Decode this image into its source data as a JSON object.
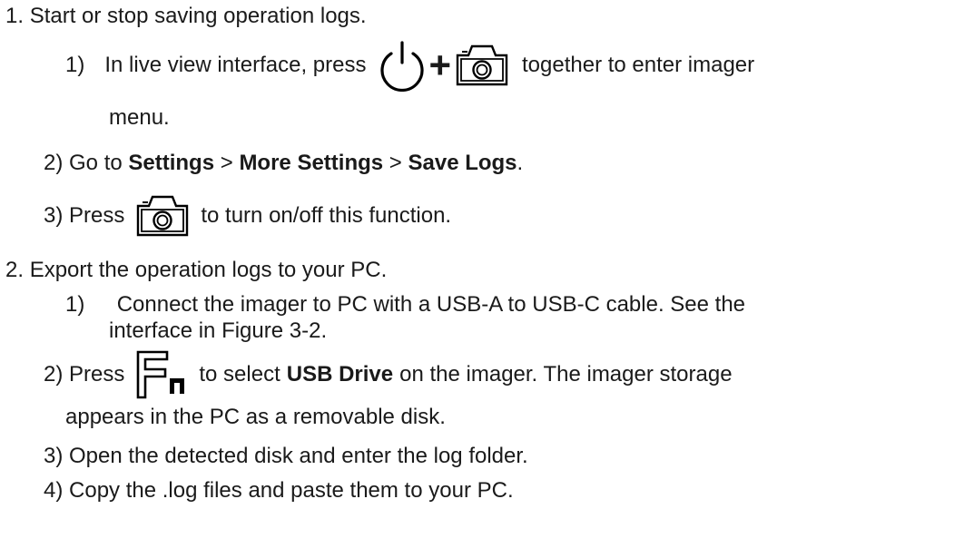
{
  "step1": {
    "number": "1.",
    "title": "Start or stop saving operation logs.",
    "sub1": {
      "number": "1)",
      "text_before": "In live view interface, press",
      "plus": "+",
      "text_after": "together to enter imager",
      "text_cont": "menu.",
      "icons": [
        "power-icon",
        "camera-icon"
      ]
    },
    "sub2": {
      "prefix": "2) Go to",
      "settings": "Settings",
      "sep1": ">",
      "more_settings": "More Settings",
      "sep2": ">",
      "save_logs": "Save Logs",
      "end": "."
    },
    "sub3": {
      "prefix": "3) Press",
      "text_after": "to turn on/off this function.",
      "icons": [
        "camera-icon"
      ]
    }
  },
  "step2": {
    "number": "2.",
    "title": "Export the operation logs to your PC.",
    "sub1": {
      "number": "1)",
      "line1": "Connect the imager to PC with a USB-A to USB-C cable. See the",
      "line2": "interface in Figure 3-2."
    },
    "sub2": {
      "prefix": "2) Press",
      "text_mid": "to select",
      "usb_drive": "USB Drive",
      "text_after": "on the imager. The imager storage",
      "line2": "appears in the PC as a removable disk.",
      "icons": [
        "fn-icon"
      ]
    },
    "sub3": {
      "text": "3) Open the detected disk and enter the log folder."
    },
    "sub4": {
      "text": "4) Copy the .log files and paste them to your PC."
    }
  }
}
